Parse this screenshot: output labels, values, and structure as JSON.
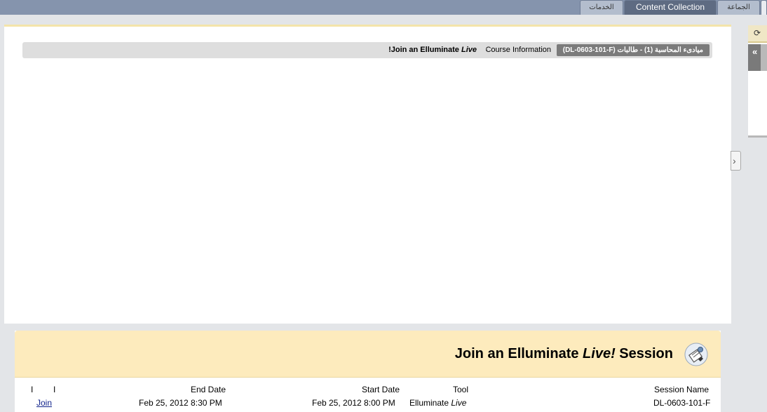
{
  "tabs": {
    "services": "الخدمات",
    "content_collection": "Content Collection",
    "community": "الجماعة"
  },
  "breadcrumb": {
    "course": "ميادىء المحاسبة (1) - طالبات (DL-0603-101-F)",
    "course_information": "Course Information",
    "separator": "‹",
    "current_prefix": "!Join an Elluminate ",
    "current_live": "Live"
  },
  "sidepanel": {
    "refresh_icon": "refresh-icon",
    "expand_icon": "double-chevron-left-icon",
    "refresh_glyph": "⟳",
    "expand_glyph": "«"
  },
  "collapse": {
    "icon": "chevron-right-icon",
    "glyph": "›"
  },
  "session": {
    "title_prefix": "Join an Elluminate ",
    "title_live": "Live!",
    "title_suffix": " Session",
    "icon": "elluminate-session-icon",
    "columns": {
      "session_name": "Session Name",
      "tool": "Tool",
      "start_date": "Start Date",
      "end_date": "End Date",
      "col_a": "I",
      "col_b": "I"
    },
    "row": {
      "session_name": "DL-0603-101-F",
      "tool_prefix": "Elluminate ",
      "tool_live": "Live",
      "start_date": "Feb 25, 2012 8:00 PM",
      "end_date": "Feb 25, 2012 8:30 PM",
      "join_label": "Join"
    }
  },
  "colors": {
    "topbar": "#8594ad",
    "tab_dark": "#5e6b82",
    "panel_header": "#fdebbd",
    "link": "#12248c"
  }
}
